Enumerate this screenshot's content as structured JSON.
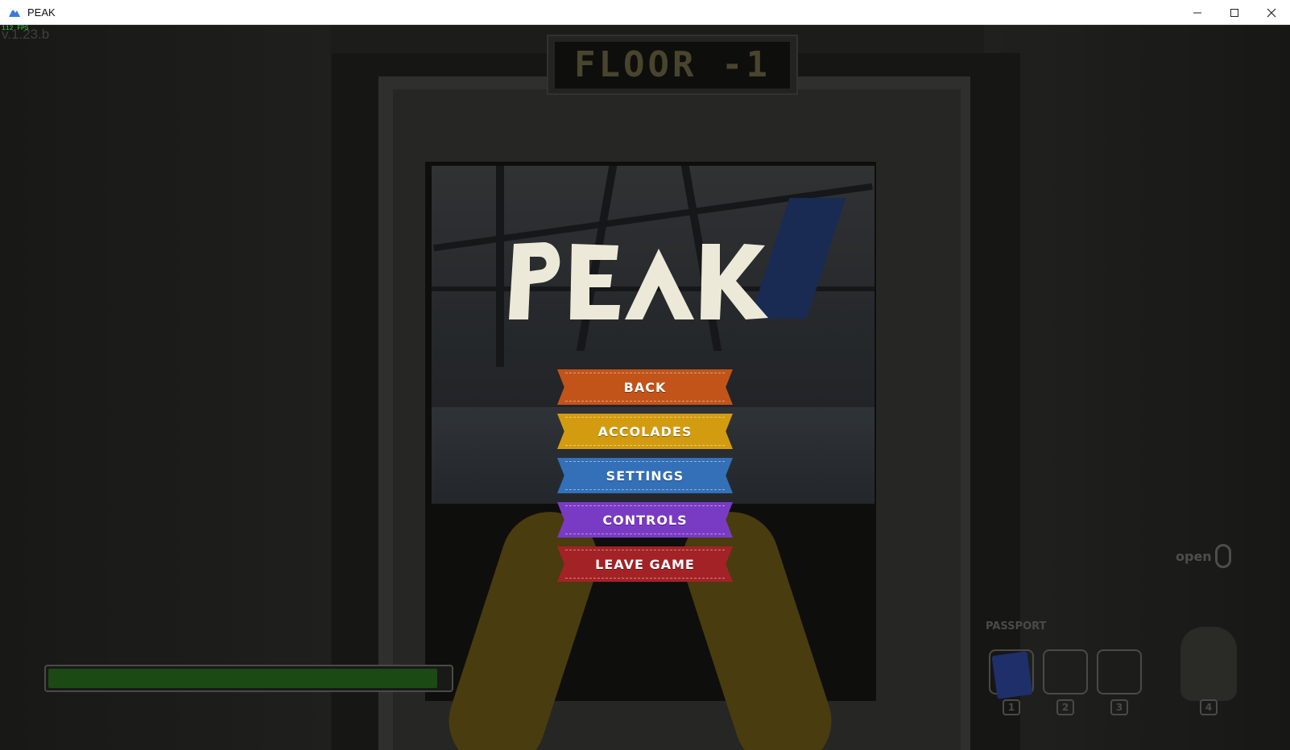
{
  "window": {
    "title": "PEAK",
    "icons": {
      "app": "peak-mountain-icon",
      "minimize": "minimize-icon",
      "maximize": "maximize-icon",
      "close": "close-icon"
    }
  },
  "hud": {
    "version": "v.1.23.b",
    "fps": "112 FPS",
    "floor_sign": "FLOOR -1",
    "logo_text": "PEAK",
    "open_hint": "open",
    "passport_label": "PASSPORT",
    "slot_numbers": [
      "1",
      "2",
      "3",
      "4"
    ],
    "health_fraction": 0.97
  },
  "menu": {
    "items": [
      {
        "label": "BACK",
        "color": "#c2541a"
      },
      {
        "label": "ACCOLADES",
        "color": "#d39c10"
      },
      {
        "label": "SETTINGS",
        "color": "#3370b8"
      },
      {
        "label": "CONTROLS",
        "color": "#7a3bc4"
      },
      {
        "label": "LEAVE GAME",
        "color": "#a32226"
      }
    ]
  },
  "colors": {
    "health": "#1c4a14",
    "logo": "#ece9d8"
  }
}
